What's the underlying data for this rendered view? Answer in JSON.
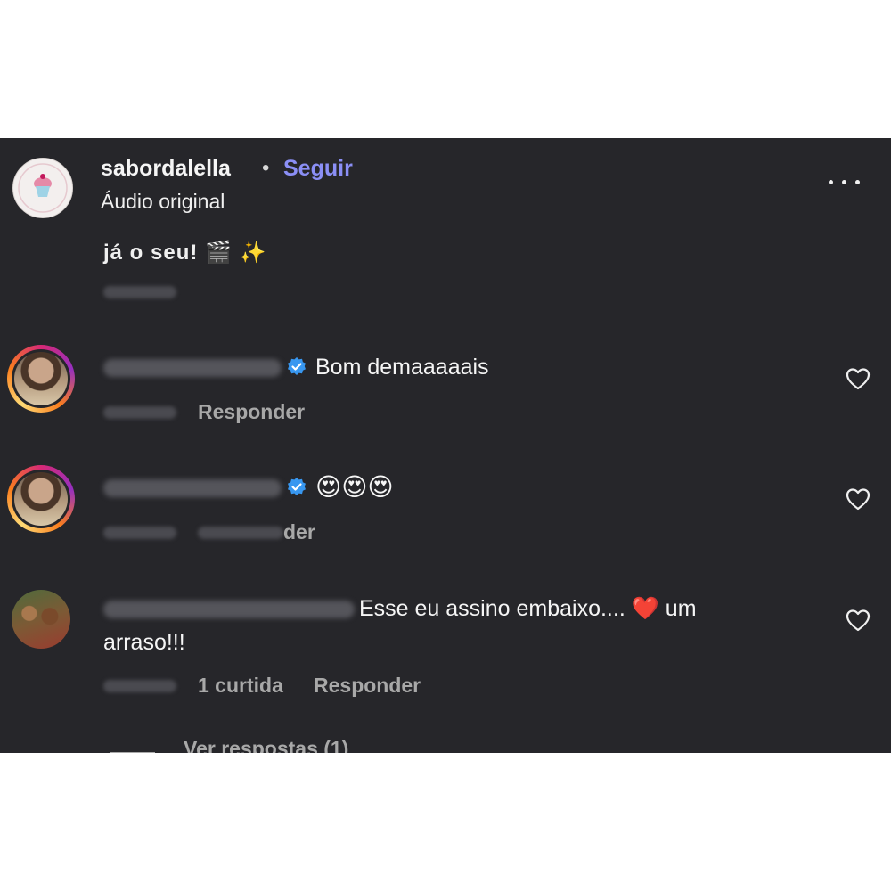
{
  "header": {
    "username": "sabordalella",
    "separator": "•",
    "follow_label": "Seguir",
    "audio_label": "Áudio original"
  },
  "previous_comment": {
    "text_fragment": "já o seu! 🎬 ✨"
  },
  "comments": [
    {
      "text": "Bom demaaaaais",
      "reply_label": "Responder",
      "verified": true
    },
    {
      "text": "😍😍😍",
      "reply_suffix": "der",
      "verified": true
    },
    {
      "text_line1": "Esse eu assino embaixo.... ❤️ um",
      "text_line2": "arraso!!!",
      "likes_label": "1 curtida",
      "reply_label": "Responder"
    }
  ],
  "view_replies_label": "Ver respostas (1)",
  "colors": {
    "background": "#26262a",
    "follow": "#8b8ff6",
    "verified": "#3897f0",
    "meta": "#a8a8a8"
  },
  "icons": [
    "more-icon",
    "verified-icon",
    "heart-icon",
    "heart-emoji"
  ]
}
